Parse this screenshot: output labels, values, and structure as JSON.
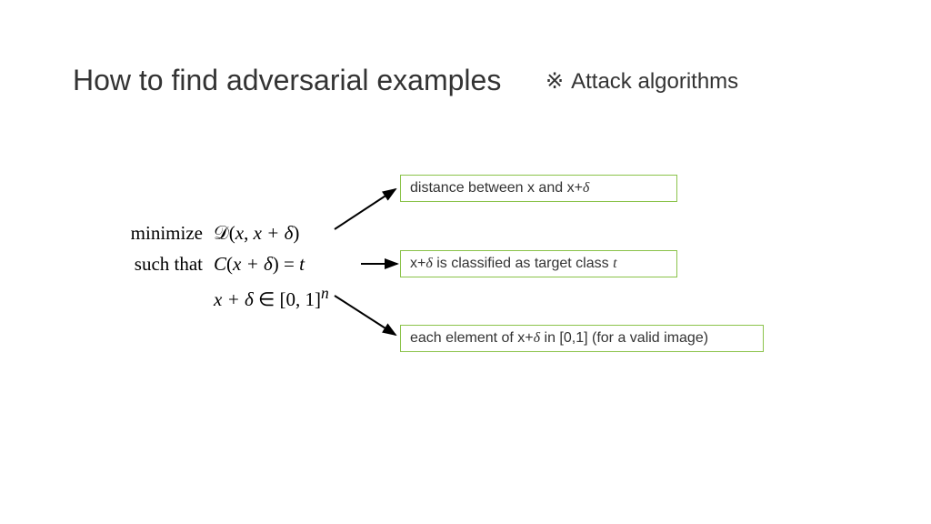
{
  "title": "How to find adversarial examples",
  "subtitle_marker": "※",
  "subtitle": "Attack algorithms",
  "math": {
    "line1_label": "minimize",
    "line1_expr_pre": "𝒟(",
    "line1_expr_x": "x",
    "line1_expr_comma": ", ",
    "line1_expr_xplus": "x + δ",
    "line1_expr_close": ")",
    "line2_label": "such that",
    "line2_expr_C": "C",
    "line2_expr_open": "(",
    "line2_expr_arg": "x + δ",
    "line2_expr_close": ") = ",
    "line2_expr_t": "t",
    "line3_label": "",
    "line3_expr_xplus": "x + δ",
    "line3_expr_in": " ∈ [0, 1]",
    "line3_expr_sup": "n"
  },
  "annotations": {
    "a1_pre": "distance between x and x+",
    "a1_delta": "δ",
    "a2_pre": "x+",
    "a2_delta": "δ",
    "a2_mid": " is classified as target class ",
    "a2_t": "t",
    "a3_pre": "each element of x+",
    "a3_delta": "δ",
    "a3_post": " in [0,1] (for a valid image)"
  }
}
